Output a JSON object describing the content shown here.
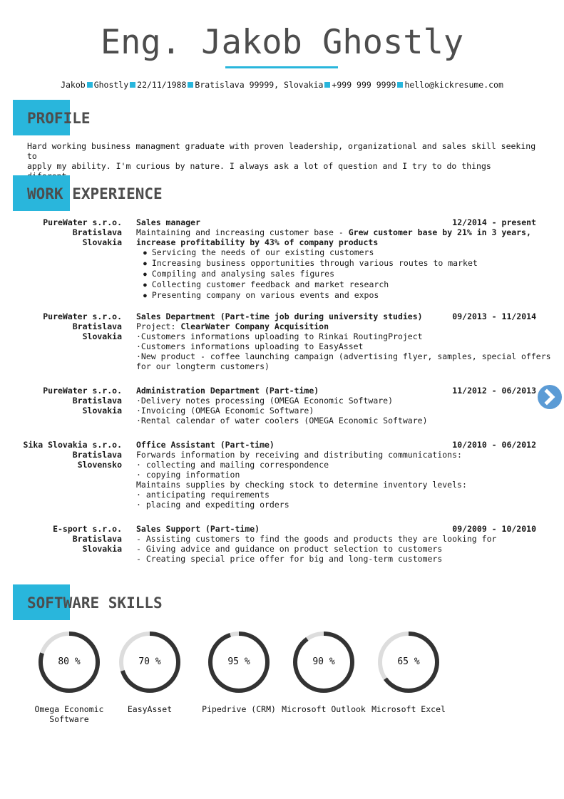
{
  "header": {
    "name": "Eng. Jakob Ghostly",
    "contact": [
      "Jakob",
      "Ghostly",
      "22/11/1988",
      "Bratislava 99999, Slovakia",
      "+999 999 9999",
      "hello@kickresume.com"
    ],
    "accent_color": "#29b6dc"
  },
  "profile": {
    "title": "PROFILE",
    "text_line1": "Hard working business managment graduate with proven leadership, organizational and sales skill seeking to",
    "text_line2": "apply my ability. I'm curious by nature. I always ask a lot of question and I try to do things diferent."
  },
  "work": {
    "title": "WORK EXPERIENCE",
    "jobs": [
      {
        "company": "PureWater s.r.o.",
        "city": "Bratislava",
        "country": "Slovakia",
        "role": "Sales manager",
        "dates": "12/2014 - present",
        "intro": "Maintaining and increasing customer base - ",
        "intro_bold1": "Grew customer base by 21% in 3 years,",
        "intro_bold2": "increase profitability by 43% of company products",
        "bullets": [
          "Servicing the needs of our existing customers",
          "Increasing business opportunities through various routes to market",
          "Compiling and analysing sales figures",
          "Collecting customer feedback and market research",
          "Presenting company on various events and expos"
        ]
      },
      {
        "company": "PureWater s.r.o.",
        "city": "Bratislava",
        "country": "Slovakia",
        "role": "Sales Department (Part-time job during university studies)",
        "dates": "09/2013 - 11/2014",
        "project_label": "Project: ",
        "project_name": "ClearWater Company Acquisition",
        "lines": [
          "·Customers informations uploading to Rinkai RoutingProject",
          "·Customers informations uploading to EasyAsset",
          "·New product - coffee launching campaign (advertising flyer, samples, special offers",
          "for our longterm customers)"
        ]
      },
      {
        "company": "PureWater s.r.o.",
        "city": "Bratislava",
        "country": "Slovakia",
        "role": "Administration Department (Part-time)",
        "dates": "11/2012 - 06/2013",
        "lines": [
          "·Delivery notes processing (OMEGA Economic Software)",
          "·Invoicing (OMEGA Economic Software)",
          "·Rental calendar of water coolers (OMEGA Economic Software)"
        ]
      },
      {
        "company": "Sika Slovakia s.r.o.",
        "city": "Bratislava",
        "country": "Slovensko",
        "role": "Office Assistant (Part-time)",
        "dates": "10/2010 - 06/2012",
        "lines": [
          "Forwards information by receiving and distributing communications:",
          "· collecting and mailing correspondence",
          "· copying information",
          "Maintains supplies by checking stock to determine inventory levels:",
          "· anticipating requirements",
          "· placing and expediting orders"
        ]
      },
      {
        "company": "E-sport s.r.o.",
        "city": "Bratislava",
        "country": "Slovakia",
        "role": "Sales Support (Part-time)",
        "dates": "09/2009 - 10/2010",
        "lines": [
          "- Assisting customers to find the goods and products they are looking for",
          "- Giving advice and guidance on product selection to customers",
          "- Creating special price offer for big and long-term customers"
        ]
      }
    ]
  },
  "skills": {
    "title": "SOFTWARE SKILLS",
    "items": [
      {
        "name_line1": "Omega Economic",
        "name_line2": "Software",
        "percent": 80,
        "label": "80 %"
      },
      {
        "name_line1": "EasyAsset",
        "name_line2": "",
        "percent": 70,
        "label": "70 %"
      },
      {
        "name_line1": "Pipedrive (CRM)",
        "name_line2": "",
        "percent": 95,
        "label": "95 %"
      },
      {
        "name_line1": "Microsoft Outlook",
        "name_line2": "",
        "percent": 90,
        "label": "90 %"
      },
      {
        "name_line1": "Microsoft Excel",
        "name_line2": "",
        "percent": 65,
        "label": "65 %"
      }
    ],
    "ring_color": "#333333",
    "track_color": "#dddddd"
  },
  "nav": {
    "next_icon": "chevron-right-icon",
    "color": "#5b9bd5"
  }
}
